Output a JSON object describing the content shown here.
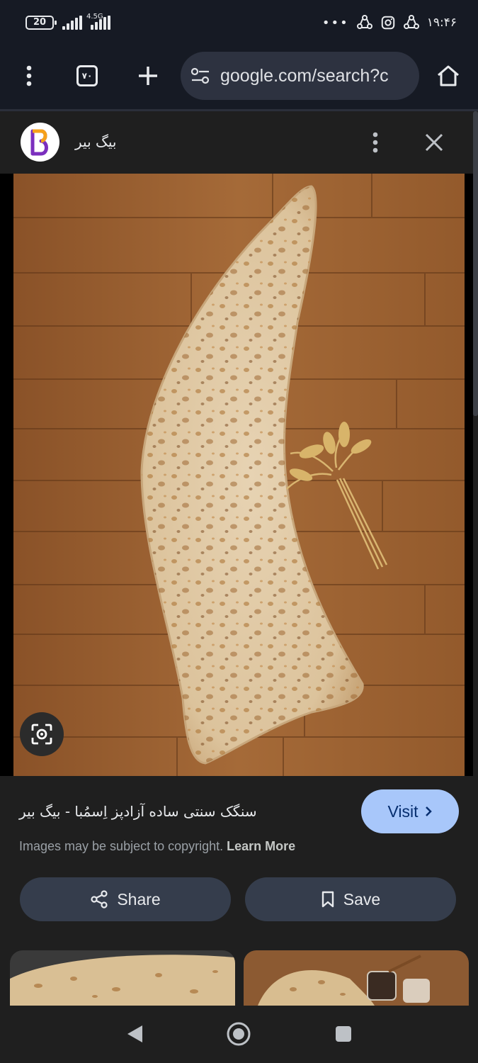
{
  "status_bar": {
    "battery": "20",
    "network": "4.5G",
    "time": "۱۹:۴۶",
    "overflow": "•••"
  },
  "browser": {
    "tab_count": "۷۰",
    "url": "google.com/search?c",
    "icons": [
      "more-vert-icon",
      "tab-switcher-icon",
      "new-tab-plus-icon",
      "site-settings-icon",
      "home-icon"
    ]
  },
  "site": {
    "title": "بیگ بیر",
    "favicon": "big-bear-logo",
    "brand_color": "#7b2fbe"
  },
  "result": {
    "title": "سنگک سنتی ساده آزادپز اِسمُبا - بیگ بیر",
    "visit_label": "Visit",
    "copyright_text": "Images may be subject to copyright.",
    "learn_more": "Learn More",
    "share_label": "Share",
    "save_label": "Save"
  },
  "colors": {
    "background": "#1f1f1f",
    "toolbar": "#161a24",
    "visit_button": "#a8c7fa",
    "action_button": "#353d4c"
  }
}
